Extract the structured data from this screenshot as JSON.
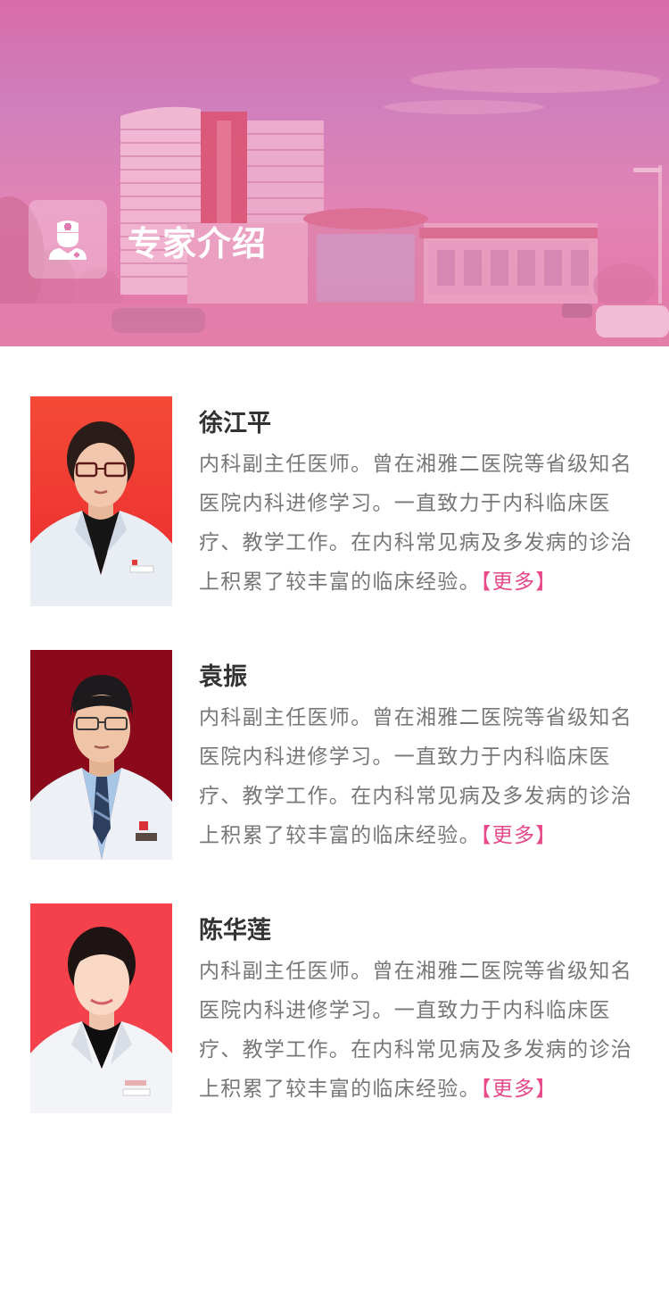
{
  "header": {
    "title": "专家介绍",
    "icon": "doctor-icon"
  },
  "doctors": [
    {
      "name": "徐江平",
      "description": "内科副主任医师。曾在湘雅二医院等省级知名医院内科进修学习。一直致力于内科临床医疗、教学工作。在内科常见病及多发病的诊治上积累了较丰富的临床经验。",
      "more_label": "【更多】",
      "photo_bg": "#f23a32"
    },
    {
      "name": "袁振",
      "description": "内科副主任医师。曾在湘雅二医院等省级知名医院内科进修学习。一直致力于内科临床医疗、教学工作。在内科常见病及多发病的诊治上积累了较丰富的临床经验。",
      "more_label": "【更多】",
      "photo_bg": "#8c0a1c"
    },
    {
      "name": "陈华莲",
      "description": "内科副主任医师。曾在湘雅二医院等省级知名医院内科进修学习。一直致力于内科临床医疗、教学工作。在内科常见病及多发病的诊治上积累了较丰富的临床经验。",
      "more_label": "【更多】",
      "photo_bg": "#f5404a"
    }
  ],
  "colors": {
    "accent": "#e6488a",
    "banner": "#e07ab0",
    "name_text": "#333333",
    "desc_text": "#777777"
  }
}
